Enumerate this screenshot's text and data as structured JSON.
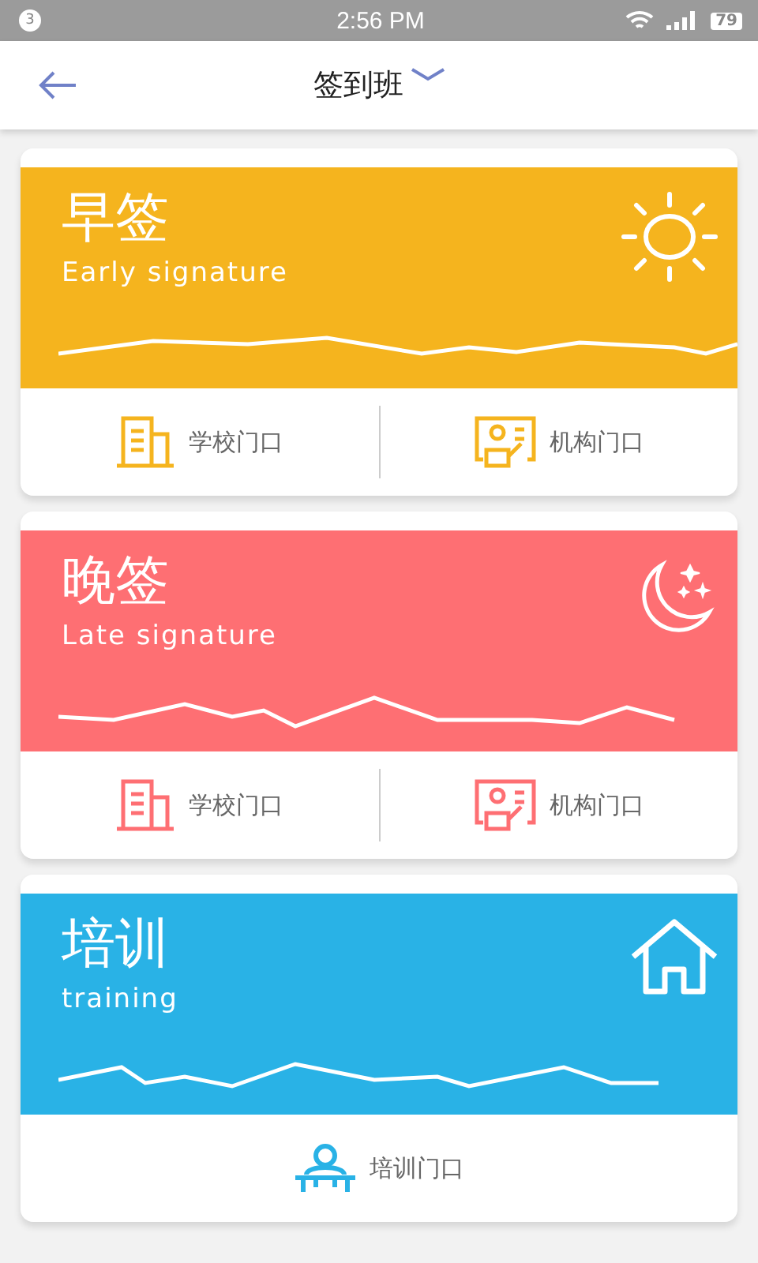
{
  "status_bar": {
    "notification_count": "3",
    "time": "2:56 PM",
    "battery": "79"
  },
  "header": {
    "title": "签到班"
  },
  "cards": [
    {
      "kind": "sun",
      "color": "#f5b41e",
      "title": "早签",
      "subtitle": "Early signature",
      "actions": [
        {
          "kind": "school",
          "label": "学校门口"
        },
        {
          "kind": "agency",
          "label": "机构门口"
        }
      ]
    },
    {
      "kind": "moon",
      "color": "#fe6f73",
      "title": "晚签",
      "subtitle": "Late signature",
      "actions": [
        {
          "kind": "school",
          "label": "学校门口"
        },
        {
          "kind": "agency",
          "label": "机构门口"
        }
      ]
    },
    {
      "kind": "house",
      "color": "#29b2e6",
      "title": "培训",
      "subtitle": "training",
      "actions": [
        {
          "kind": "training",
          "label": "培训门口"
        }
      ]
    }
  ]
}
